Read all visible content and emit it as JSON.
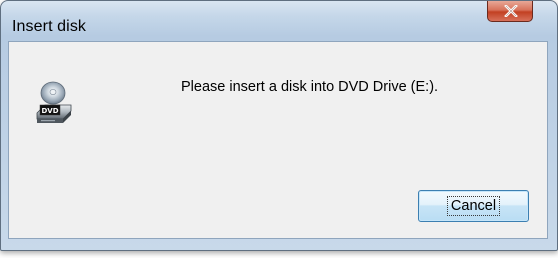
{
  "window": {
    "title": "Insert disk"
  },
  "titlebar": {
    "close_icon": "close-x-icon"
  },
  "content": {
    "icon": "dvd-drive-icon",
    "icon_label": "DVD",
    "message": "Please insert a disk into DVD Drive (E:)."
  },
  "buttons": {
    "cancel_label": "Cancel"
  },
  "colors": {
    "close_button": "#c9492a",
    "cancel_border": "#3c7fb1",
    "client_background": "#f0f0f0"
  }
}
